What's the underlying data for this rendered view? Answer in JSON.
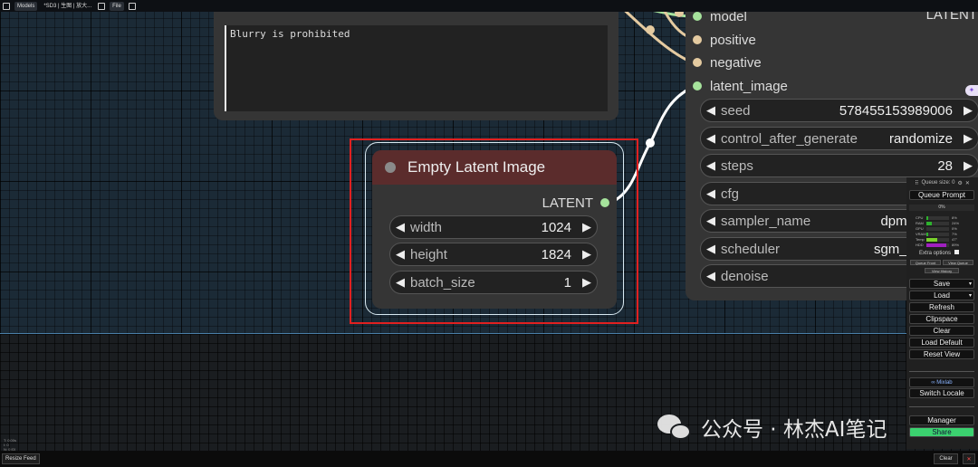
{
  "topbar": {
    "models_label": "Models",
    "workflow_label": "*SD3 | 生图 | 放大...",
    "file_label": "File"
  },
  "negative_prompt": {
    "text": "Blurry is prohibited"
  },
  "ksampler": {
    "inputs": [
      {
        "label": "model",
        "color": "#a6e39c"
      },
      {
        "label": "positive",
        "color": "#e4caa0"
      },
      {
        "label": "negative",
        "color": "#e4caa0"
      },
      {
        "label": "latent_image",
        "color": "#a6e39c"
      }
    ],
    "output_label": "LATENT",
    "widgets": [
      {
        "label": "seed",
        "value": "578455153989006"
      },
      {
        "label": "control_after_generate",
        "value": "randomize"
      },
      {
        "label": "steps",
        "value": "28"
      },
      {
        "label": "cfg",
        "value": ""
      },
      {
        "label": "sampler_name",
        "value": "dpmp"
      },
      {
        "label": "scheduler",
        "value": "sgm_u"
      },
      {
        "label": "denoise",
        "value": ""
      }
    ]
  },
  "empty_latent": {
    "title": "Empty Latent Image",
    "output_label": "LATENT",
    "widgets": [
      {
        "label": "width",
        "value": "1024"
      },
      {
        "label": "height",
        "value": "1824"
      },
      {
        "label": "batch_size",
        "value": "1"
      }
    ],
    "title_color": "#5b2c2c"
  },
  "queue_panel": {
    "queue_size": "Queue size: 0",
    "queue_prompt": "Queue Prompt",
    "progress": "0%",
    "stats": [
      {
        "label": "CPU",
        "value": "8%",
        "fill": 0.08,
        "color": "#2db22d"
      },
      {
        "label": "RAM",
        "value": "24%",
        "fill": 0.24,
        "color": "#2db22d"
      },
      {
        "label": "GPU",
        "value": "0%",
        "fill": 0.0,
        "color": "#2db22d"
      },
      {
        "label": "VRAM",
        "value": "7%",
        "fill": 0.07,
        "color": "#2db22d"
      },
      {
        "label": "Temp",
        "value": "47°",
        "fill": 0.47,
        "color": "#7ad12b"
      },
      {
        "label": "HDD",
        "value": "89%",
        "fill": 0.89,
        "color": "#a020c0"
      }
    ],
    "extra_options": "Extra options",
    "queue_front": "Queue Front",
    "view_queue": "View Queue",
    "view_history": "View History",
    "save": "Save",
    "load": "Load",
    "refresh": "Refresh",
    "clipspace": "Clipspace",
    "clear": "Clear",
    "load_default": "Load Default",
    "reset_view": "Reset View",
    "mixlab": "∞ Mixlab",
    "switch_locale": "Switch Locale",
    "manager": "Manager",
    "share": "Share"
  },
  "bottombar": {
    "resize_feed": "Resize Feed",
    "clear": "Clear",
    "close": "✕"
  },
  "coords": {
    "line1": "T: 0.00s",
    "line2": "I: 0",
    "line3": "N: 0 [0]",
    "line4": "V: 0"
  },
  "watermark": {
    "text": "公众号 · 林杰AI笔记"
  },
  "colors": {
    "link_latent": "#ffffff",
    "link_model": "#a6e39c",
    "link_conditioning": "#e4caa0",
    "selection_box": "#e02020"
  }
}
